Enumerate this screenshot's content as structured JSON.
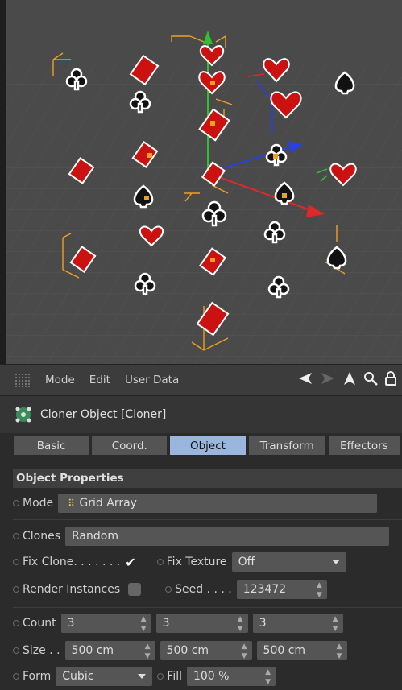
{
  "menubar": {
    "items": [
      "Mode",
      "Edit",
      "User Data"
    ]
  },
  "object": {
    "title": "Cloner Object [Cloner]"
  },
  "tabs": [
    "Basic",
    "Coord.",
    "Object",
    "Transform",
    "Effectors"
  ],
  "active_tab": "Object",
  "section": {
    "title": "Object Properties"
  },
  "fields": {
    "mode_label": "Mode",
    "mode_value": "Grid Array",
    "clones_label": "Clones",
    "clones_value": "Random",
    "fix_clone_label": "Fix Clone. . . . . . .",
    "fix_clone_checked": true,
    "fix_texture_label": "Fix Texture",
    "fix_texture_value": "Off",
    "render_instances_label": "Render Instances",
    "render_instances_checked": false,
    "seed_label": "Seed . . . .",
    "seed_value": "123472",
    "count_label": "Count",
    "count_values": [
      "3",
      "3",
      "3"
    ],
    "size_label": "Size . .",
    "size_values": [
      "500 cm",
      "500 cm",
      "500 cm"
    ],
    "form_label": "Form",
    "form_value": "Cubic",
    "fill_label": "Fill",
    "fill_value": "100 %"
  },
  "colors": {
    "active_tab": "#9bb6de",
    "viewport_bg": "#4a4a4a",
    "selection": "#f0a020",
    "diamond": "#cc1111"
  },
  "icons": [
    "back-arrow-icon",
    "forward-arrow-icon",
    "pointer-icon",
    "search-icon",
    "lock-icon",
    "cloner-icon"
  ]
}
